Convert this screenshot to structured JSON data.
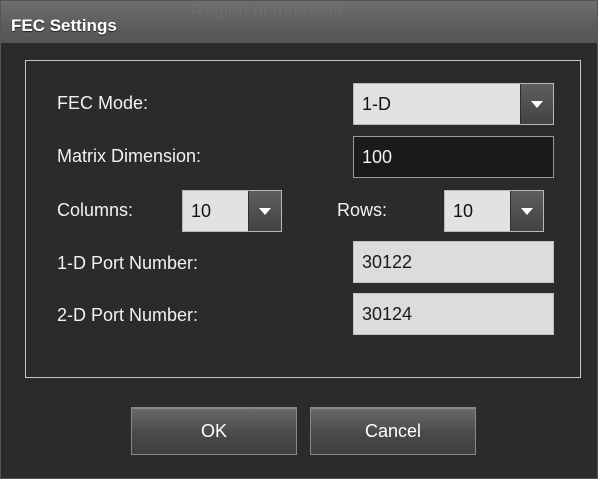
{
  "window": {
    "title": "FEC Settings",
    "background_text": "Region of Interests"
  },
  "form": {
    "fec_mode_label": "FEC Mode:",
    "fec_mode_value": "1-D",
    "matrix_dimension_label": "Matrix Dimension:",
    "matrix_dimension_value": "100",
    "columns_label": "Columns:",
    "columns_value": "10",
    "rows_label": "Rows:",
    "rows_value": "10",
    "port_1d_label": "1-D Port Number:",
    "port_1d_value": "30122",
    "port_2d_label": "2-D Port Number:",
    "port_2d_value": "30124"
  },
  "buttons": {
    "ok_label": "OK",
    "cancel_label": "Cancel"
  },
  "icons": {
    "dropdown_arrow": "chevron-down-icon"
  },
  "colors": {
    "dialog_background": "#2b2b2b",
    "titlebar": "#5c5c5c",
    "text": "#f2f2f2",
    "readonly_field": "#dcdcdc"
  }
}
